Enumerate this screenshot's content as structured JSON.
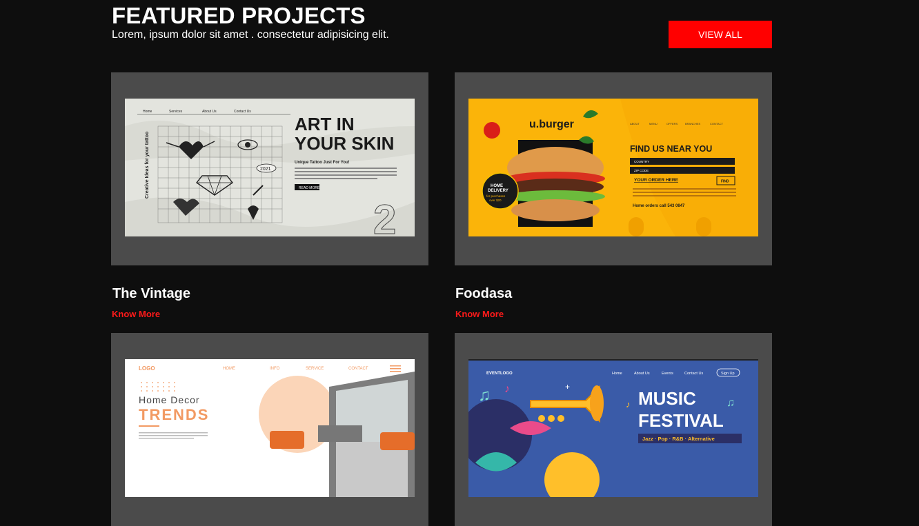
{
  "header": {
    "title": "FEATURED PROJECTS",
    "subtitle": "Lorem, ipsum dolor sit amet . consectetur adipisicing elit.",
    "view_all_label": "VIEW ALL"
  },
  "colors": {
    "background": "#0e0e0e",
    "accent": "#ff0000",
    "card_frame": "#4b4b4b"
  },
  "projects": [
    {
      "title": "The Vintage",
      "link_label": "Know More",
      "preview": {
        "nav": [
          "Home",
          "Services",
          "About Us",
          "Contact Us"
        ],
        "headline_1": "ART IN",
        "headline_2": "YOUR SKIN",
        "side_text": "Creative Ideas for your tattoo",
        "tagline": "Unique Tattoo Just For You!",
        "button": "READ MORE",
        "badge": "2021"
      }
    },
    {
      "title": "Foodasa",
      "link_label": "Know More",
      "preview": {
        "logo": "u.burger",
        "nav": [
          "ABOUT",
          "MENU",
          "OFFERS",
          "BRANCHES",
          "CONTACT"
        ],
        "headline": "FIND US NEAR YOU",
        "country": "COUNTRY",
        "zip": "ZIP CODE",
        "order_link": "YOUR ORDER HERE",
        "find": "FIND",
        "home_orders": "Home orders call 543 0847",
        "delivery_1": "HOME",
        "delivery_2": "DELIVERY",
        "delivery_3": "for purchases",
        "delivery_4": "over $20"
      }
    },
    {
      "title": "",
      "link_label": "",
      "preview": {
        "logo": "LOGO",
        "nav": [
          "HOME",
          "INFO",
          "SERVICE",
          "CONTACT"
        ],
        "headline_1": "Home  Decor",
        "headline_2": "TRENDS"
      }
    },
    {
      "title": "",
      "link_label": "",
      "preview": {
        "logo": "EVENTLOGO",
        "nav": [
          "Home",
          "About Us",
          "Events",
          "Contact Us"
        ],
        "signup": "Sign Up",
        "headline_1": "MUSIC",
        "headline_2": "FESTIVAL",
        "genres": "Jazz · Pop · R&B · Alternative"
      }
    }
  ]
}
